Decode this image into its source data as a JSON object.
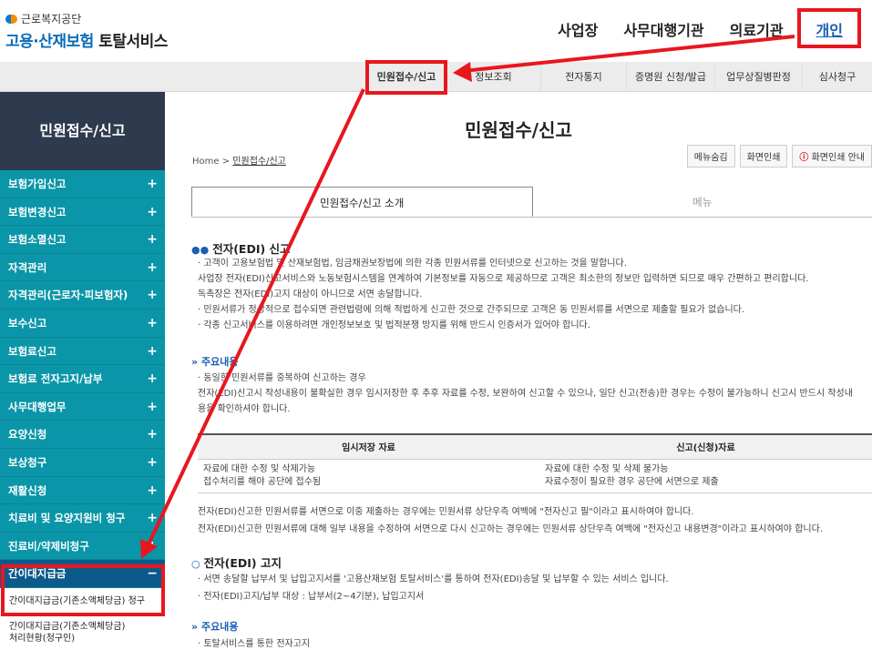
{
  "header": {
    "org_name": "근로복지공단",
    "service_name_blue": "고용·산재보험",
    "service_name_dark": "토탈서비스",
    "top_nav": [
      "사업장",
      "사무대행기관",
      "의료기관",
      "개인"
    ]
  },
  "gnb": {
    "tabs": [
      "민원접수/신고",
      "정보조회",
      "전자통지",
      "증명원 신청/발급",
      "업무상질병판정",
      "심사청구"
    ]
  },
  "sidebar": {
    "title": "민원접수/신고",
    "items": [
      "보험가입신고",
      "보험변경신고",
      "보험소멸신고",
      "자격관리",
      "자격관리(근로자·피보험자)",
      "보수신고",
      "보험료신고",
      "보험료 전자고지/납부",
      "사무대행업무",
      "요양신청",
      "보상청구",
      "재활신청",
      "치료비 및 요양지원비 청구",
      "진료비/약제비청구",
      "간이대지급금"
    ],
    "sub_items": [
      "간이대지급금(기존소액체당금) 청구",
      "간이대지급금(기존소액체당금)\n처리현황(청구인)"
    ]
  },
  "content": {
    "title": "민원접수/신고",
    "breadcrumb_home": "Home",
    "breadcrumb_sep": ">",
    "breadcrumb_current": "민원접수/신고",
    "util_buttons": [
      "메뉴숨김",
      "화면인쇄",
      "화면인쇄 안내"
    ],
    "tabs": [
      "민원접수/신고 소개",
      "메뉴"
    ],
    "sec1_title": "전자(EDI) 신고",
    "sec1_lines": [
      "· 고객이 고용보험법 및 산재보험법, 임금채권보장법에 의한 각종 민원서류를 인터넷으로 신고하는 것을 말합니다.",
      "  사업장 전자(EDI)신고서비스와 노동보험시스템을 연계하여 기본정보를 자동으로 제공하므로 고객은 최소한의 정보만 입력하면 되므로 매우 간편하고 편리합니다.",
      "  독촉장은 전자(EDI)고지 대상이 아니므로 서면 송달합니다.",
      "· 민원서류가 정상적으로 접수되면 관련법령에 의해 적법하게 신고한 것으로 간주되므로 고객은 동 민원서류를 서면으로 제출할 필요가 없습니다.",
      "· 각종 신고서비스를 이용하려면 개인정보보호 및 법적분쟁 방지를 위해 반드시 인증서가 있어야 합니다."
    ],
    "sub1_title": "주요내용",
    "sub1_lines": [
      "· 동일한 민원서류를 중복하여 신고하는 경우",
      "  전자(EDI)신고시 작성내용이 불확실한 경우 임시저장한 후 추후 자료를 수정, 보완하여 신고할 수 있으나, 일단 신고(전송)한 경우는 수정이 불가능하니 신고시 반드시 작성내",
      "  용을 확인하셔야 합니다."
    ],
    "table": {
      "headers": [
        "임시저장 자료",
        "신고(신청)자료"
      ],
      "rows": [
        [
          "자료에 대한 수정 및 삭제가능\n접수처리를 해야 공단에 접수됨",
          "자료에 대한 수정 및 삭제 불가능\n자료수정이 필요한 경우 공단에 서면으로 제출"
        ]
      ]
    },
    "after_table": [
      "전자(EDI)신고한 민원서류를 서면으로 이중 제출하는 경우에는 민원서류 상단우측 여백에 \"전자신고 필\"이라고 표시하여야 합니다.",
      "전자(EDI)신고한 민원서류에 대해 일부 내용을 수정하여 서면으로 다시 신고하는 경우에는 민원서류 상단우측 여백에 \"전자신고 내용변경\"이라고 표시하여야 합니다."
    ],
    "sec2_title": "전자(EDI) 고지",
    "sec2_lines": [
      "· 서면 송달할 납부서 및 납입고지서를 '고용산재보험 토탈서비스'를 통하여 전자(EDI)송달 및 납부할 수 있는 서비스 입니다.",
      "· 전자(EDI)고지/납부 대상 : 납부서(2~4기분), 납입고지서"
    ],
    "sub2_title": "주요내용",
    "sub2_line": "· 토탈서비스를 통한 전자고지"
  },
  "colors": {
    "sidebar_teal": "#0a96a8",
    "sidebar_title_bg": "#2e3b4e",
    "highlight_red": "#e8171e",
    "link_blue": "#1a5fb4"
  }
}
